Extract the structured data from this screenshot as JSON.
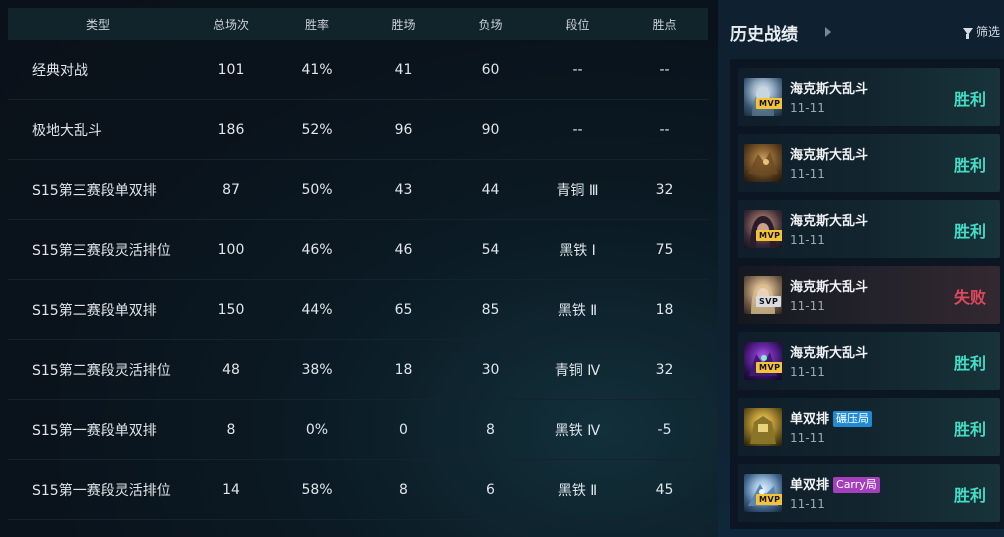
{
  "table": {
    "headers": [
      "类型",
      "总场次",
      "胜率",
      "胜场",
      "负场",
      "段位",
      "胜点"
    ],
    "rows": [
      {
        "type": "经典对战",
        "total": "101",
        "rate": "41%",
        "win": "41",
        "lose": "60",
        "rank": "--",
        "pts": "--"
      },
      {
        "type": "极地大乱斗",
        "total": "186",
        "rate": "52%",
        "win": "96",
        "lose": "90",
        "rank": "--",
        "pts": "--"
      },
      {
        "type": "S15第三赛段单双排",
        "total": "87",
        "rate": "50%",
        "win": "43",
        "lose": "44",
        "rank": "青铜 Ⅲ",
        "pts": "32"
      },
      {
        "type": "S15第三赛段灵活排位",
        "total": "100",
        "rate": "46%",
        "win": "46",
        "lose": "54",
        "rank": "黑铁 Ⅰ",
        "pts": "75"
      },
      {
        "type": "S15第二赛段单双排",
        "total": "150",
        "rate": "44%",
        "win": "65",
        "lose": "85",
        "rank": "黑铁 Ⅱ",
        "pts": "18"
      },
      {
        "type": "S15第二赛段灵活排位",
        "total": "48",
        "rate": "38%",
        "win": "18",
        "lose": "30",
        "rank": "青铜 Ⅳ",
        "pts": "32"
      },
      {
        "type": "S15第一赛段单双排",
        "total": "8",
        "rate": "0%",
        "win": "0",
        "lose": "8",
        "rank": "黑铁 Ⅳ",
        "pts": "-5"
      },
      {
        "type": "S15第一赛段灵活排位",
        "total": "14",
        "rate": "58%",
        "win": "8",
        "lose": "6",
        "rank": "黑铁 Ⅱ",
        "pts": "45"
      }
    ]
  },
  "history": {
    "title": "历史战绩",
    "filter_label": "筛选",
    "colors": {
      "win": "#43dcc5",
      "lose": "#e0495b",
      "mvp": "#f3c43a"
    },
    "matches": [
      {
        "mode": "海克斯大乱斗",
        "date": "11-11",
        "result": "胜利",
        "badge": "MVP",
        "tag": "",
        "avatar_icon": "champion-portrait-white-haired-icon"
      },
      {
        "mode": "海克斯大乱斗",
        "date": "11-11",
        "result": "胜利",
        "badge": "",
        "tag": "",
        "avatar_icon": "champion-portrait-beast-icon"
      },
      {
        "mode": "海克斯大乱斗",
        "date": "11-11",
        "result": "胜利",
        "badge": "MVP",
        "tag": "",
        "avatar_icon": "champion-portrait-dark-haired-icon"
      },
      {
        "mode": "海克斯大乱斗",
        "date": "11-11",
        "result": "失败",
        "badge": "SVP",
        "tag": "",
        "avatar_icon": "champion-portrait-blonde-icon"
      },
      {
        "mode": "海克斯大乱斗",
        "date": "11-11",
        "result": "胜利",
        "badge": "MVP",
        "tag": "",
        "avatar_icon": "champion-portrait-void-icon"
      },
      {
        "mode": "单双排",
        "date": "11-11",
        "result": "胜利",
        "badge": "",
        "tag": "碾压局",
        "avatar_icon": "champion-portrait-golden-icon"
      },
      {
        "mode": "单双排",
        "date": "11-11",
        "result": "胜利",
        "badge": "MVP",
        "tag": "Carry局",
        "avatar_icon": "champion-portrait-ice-icon"
      }
    ]
  }
}
